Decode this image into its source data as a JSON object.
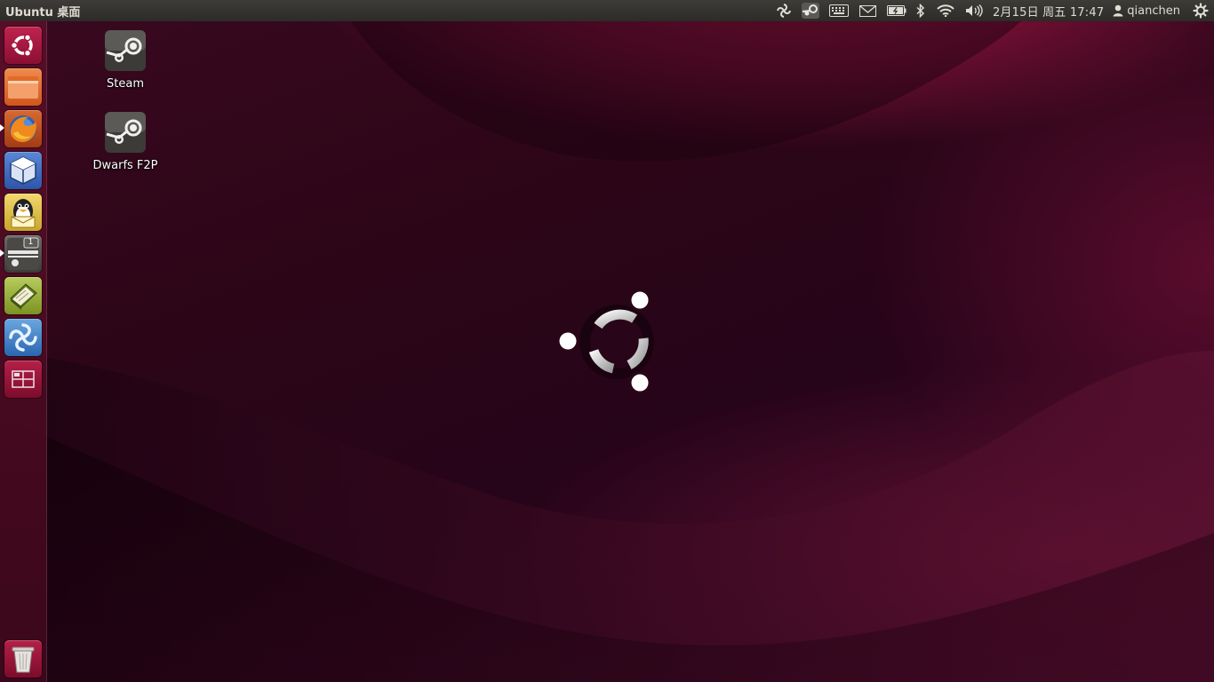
{
  "panel": {
    "title": "Ubuntu 桌面",
    "clock": "2月15日 周五 17:47",
    "user": "qianchen",
    "indicator_icons": [
      "steam-tray-icon",
      "steam-icon",
      "keyboard-icon",
      "mail-icon",
      "battery-icon",
      "bluetooth-icon",
      "wifi-icon",
      "volume-icon",
      "user-icon",
      "session-gear-icon"
    ]
  },
  "launcher": {
    "items": [
      {
        "name": "dash-home",
        "icon": "ubuntu-logo-icon"
      },
      {
        "name": "files",
        "icon": "folder-icon"
      },
      {
        "name": "firefox",
        "icon": "firefox-icon"
      },
      {
        "name": "virtualbox",
        "icon": "virtualbox-icon"
      },
      {
        "name": "qq",
        "icon": "penguin-icon"
      },
      {
        "name": "steam",
        "icon": "steam-icon",
        "badge": "1"
      },
      {
        "name": "book-reader",
        "icon": "book-icon"
      },
      {
        "name": "shotwell",
        "icon": "shotwell-icon"
      },
      {
        "name": "workspace-switcher",
        "icon": "workspace-icon"
      },
      {
        "name": "trash",
        "icon": "trash-icon"
      }
    ]
  },
  "desktop": {
    "icons": [
      {
        "label": "Steam",
        "icon": "steam-icon"
      },
      {
        "label": "Dwarfs F2P",
        "icon": "steam-icon"
      }
    ]
  },
  "colors": {
    "panel": "#3a3935",
    "wallpaper_dark": "#2a0616",
    "wallpaper_accent": "#9a1840",
    "launcher": "#5c0e28"
  }
}
